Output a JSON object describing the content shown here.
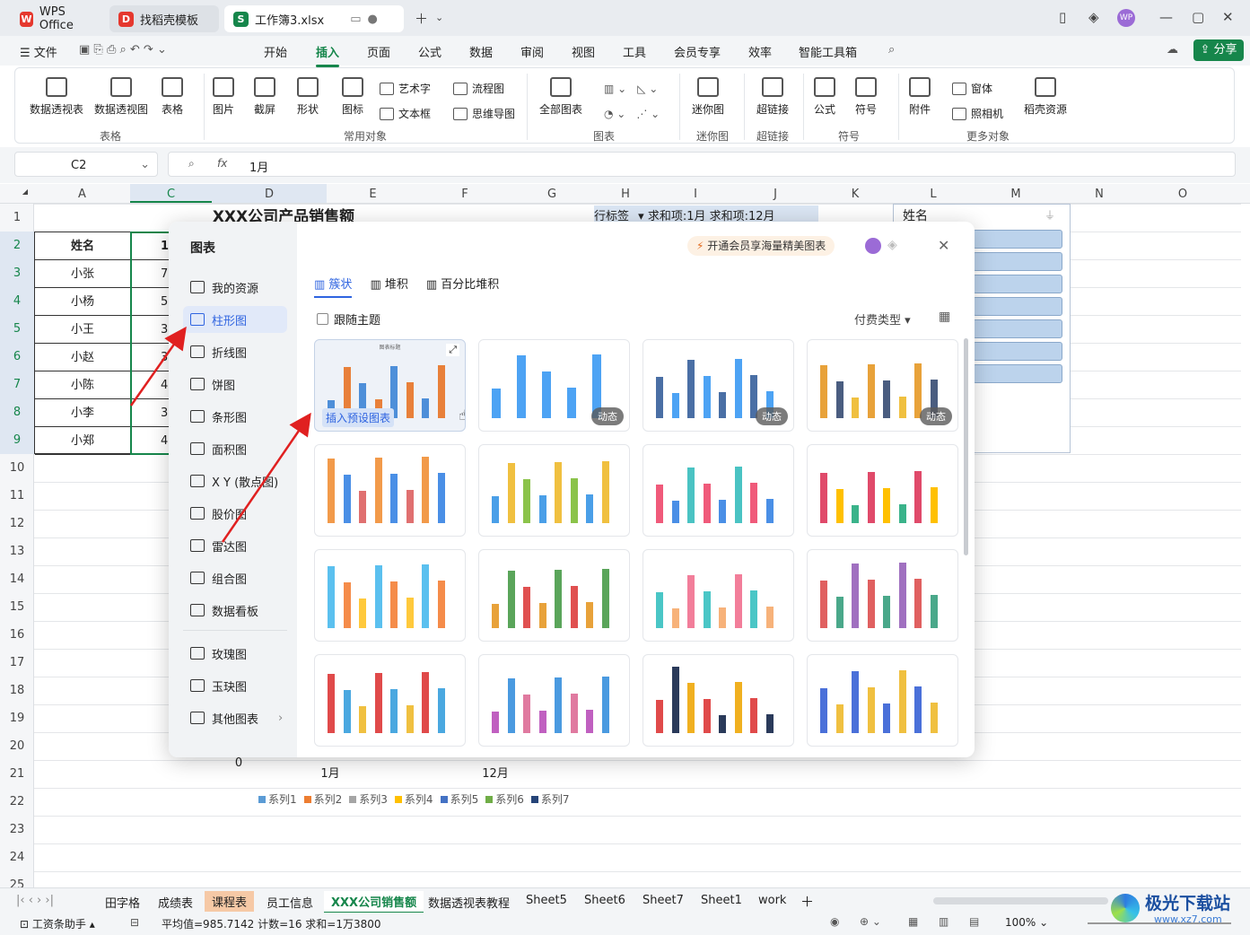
{
  "titlebar": {
    "tabs": [
      {
        "label": "WPS Office"
      },
      {
        "label": "找稻壳模板"
      },
      {
        "label": "工作簿3.xlsx"
      }
    ],
    "avatar": "WP"
  },
  "menubar": {
    "file": "文件",
    "items": [
      "开始",
      "插入",
      "页面",
      "公式",
      "数据",
      "审阅",
      "视图",
      "工具",
      "会员专享",
      "效率",
      "智能工具箱"
    ],
    "active": "插入",
    "share": "分享"
  },
  "ribbon": {
    "buttons": [
      "数据透视表",
      "数据透视图",
      "表格",
      "图片",
      "截屏",
      "形状",
      "图标",
      "全部图表",
      "迷你图",
      "超链接",
      "公式",
      "符号",
      "附件",
      "稻壳资源"
    ],
    "small": [
      "艺术字",
      "文本框",
      "流程图",
      "思维导图",
      "窗体",
      "照相机"
    ],
    "groups": [
      "表格",
      "常用对象",
      "图表",
      "迷你图",
      "超链接",
      "符号",
      "更多对象"
    ]
  },
  "formula": {
    "cell": "C2",
    "fx": "fx",
    "value": "1月"
  },
  "columns": [
    "A",
    "C",
    "D",
    "E",
    "F",
    "G",
    "H",
    "I",
    "J",
    "K",
    "L",
    "M",
    "N",
    "O"
  ],
  "rows": [
    "1",
    "2",
    "3",
    "4",
    "5",
    "6",
    "7",
    "8",
    "9",
    "10",
    "11",
    "12",
    "13",
    "14",
    "15",
    "16",
    "17",
    "18",
    "19",
    "20",
    "21",
    "22",
    "23",
    "24",
    "25"
  ],
  "sheet": {
    "title": "XXX公司产品销售额",
    "header_a": "姓名",
    "header_c": "1",
    "names": [
      "小张",
      "小杨",
      "小王",
      "小赵",
      "小陈",
      "小李",
      "小郑"
    ],
    "vals": [
      "7",
      "5",
      "3",
      "3",
      "4",
      "3",
      "4"
    ],
    "pivot_h": "行标签",
    "pivot_i": "求和项:1月",
    "pivot_j": "求和项:12月",
    "filter_label": "姓名",
    "axis_zero": "0",
    "axis_x1": "1月",
    "axis_x2": "12月",
    "legend": [
      "系列1",
      "系列2",
      "系列3",
      "系列4",
      "系列5",
      "系列6",
      "系列7"
    ]
  },
  "dialog": {
    "title": "图表",
    "promo": "开通会员享海量精美图表",
    "side": [
      "我的资源",
      "柱形图",
      "折线图",
      "饼图",
      "条形图",
      "面积图",
      "X Y (散点图)",
      "股价图",
      "雷达图",
      "组合图",
      "数据看板",
      "玫瑰图",
      "玉玦图",
      "其他图表"
    ],
    "selected": "柱形图",
    "subtabs": [
      "簇状",
      "堆积",
      "百分比堆积"
    ],
    "follow_theme": "跟随主题",
    "pay_type": "付费类型",
    "insert_preset": "插入预设图表",
    "card1_title": "图表标题",
    "dynamic": "动态"
  },
  "sheets": {
    "tabs": [
      "田字格",
      "成绩表",
      "课程表",
      "员工信息",
      "XXX公司销售额",
      "数据透视表教程",
      "Sheet5",
      "Sheet6",
      "Sheet7",
      "Sheet1",
      "work"
    ],
    "active": "XXX公司销售额"
  },
  "status": {
    "assistant": "工资条助手",
    "stats": "平均值=985.7142  计数=16  求和=1万3800",
    "zoom": "100%"
  },
  "watermark": {
    "brand": "极光下载站",
    "url": "www.xz7.com"
  }
}
